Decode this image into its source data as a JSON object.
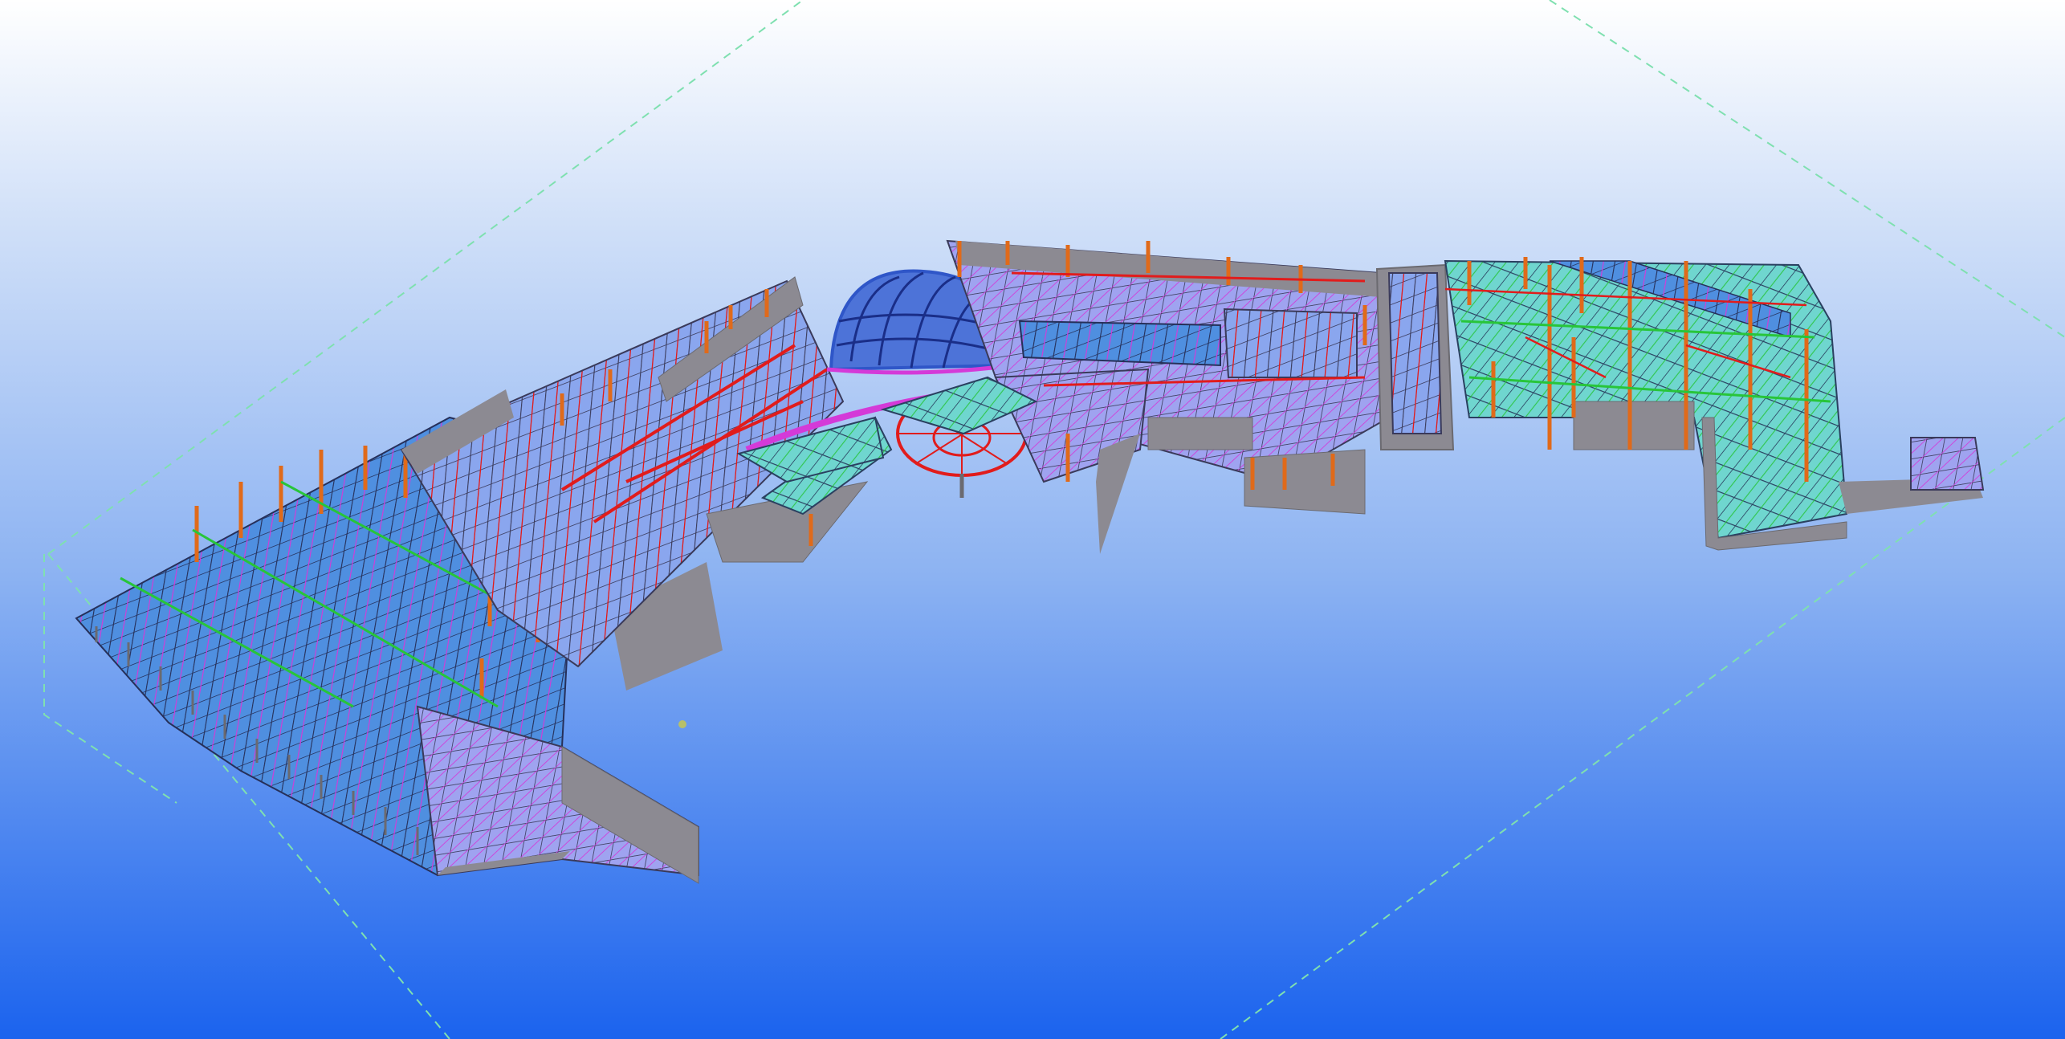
{
  "app": {
    "view": "3d-model-viewport",
    "background": {
      "top": "#ffffff",
      "mid": "#b4cdf6",
      "bottom": "#1b63ee"
    },
    "colors": {
      "wall": "#8c8a92",
      "wall_dark": "#6b6a70",
      "slab": "#4f8fe0",
      "slab_light": "#66c8e6",
      "slab_teal": "#5fd0c8",
      "beam_red": "#e11c1c",
      "beam_magenta": "#d43ad8",
      "beam_green": "#28c53a",
      "column_orange": "#e06a1a",
      "dashed_bounds": "#7fe0b0",
      "grid_dark": "#3a3a5a",
      "dome_blue": "#2f56c8"
    }
  }
}
